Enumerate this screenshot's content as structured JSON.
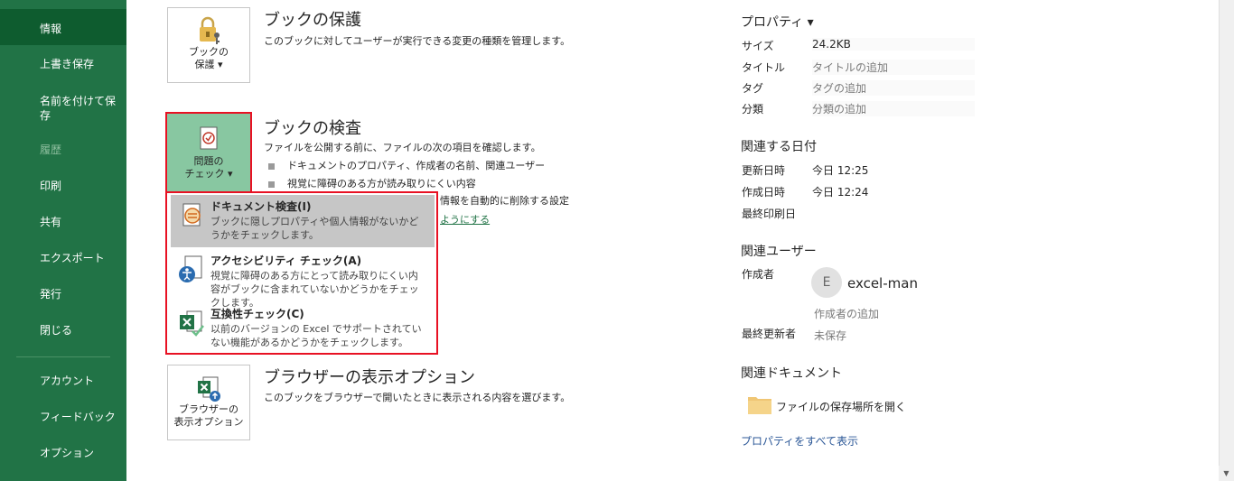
{
  "sidebar": {
    "items": [
      {
        "label": "情報"
      },
      {
        "label": "上書き保存"
      },
      {
        "label": "名前を付けて保\n存"
      },
      {
        "label": "履歴"
      },
      {
        "label": "印刷"
      },
      {
        "label": "共有"
      },
      {
        "label": "エクスポート"
      },
      {
        "label": "発行"
      },
      {
        "label": "閉じる"
      },
      {
        "label": "アカウント"
      },
      {
        "label": "フィードバック"
      },
      {
        "label": "オプション"
      }
    ]
  },
  "protect": {
    "button_line1": "ブックの",
    "button_line2": "保護 ▾",
    "title": "ブックの保護",
    "desc": "このブックに対してユーザーが実行できる変更の種類を管理します。"
  },
  "inspect": {
    "button_line1": "問題の",
    "button_line2": "チェック ▾",
    "title": "ブックの検査",
    "desc": "ファイルを公開する前に、ファイルの次の項目を確認します。",
    "bullet1": "ドキュメントのプロパティ、作成者の名前、関連ユーザー",
    "bullet2": "視覚に障碍のある方が読み取りにくい内容",
    "bullet3_tail": "情報を自動的に削除する設定",
    "link_tail": "ようにする"
  },
  "dropdown": {
    "items": [
      {
        "title": "ドキュメント検査(I)",
        "desc": "ブックに隠しプロパティや個人情報がないかどうかをチェックします。"
      },
      {
        "title": "アクセシビリティ チェック(A)",
        "desc": "視覚に障碍のある方にとって読み取りにくい内容がブックに含まれていないかどうかをチェックします。"
      },
      {
        "title": "互換性チェック(C)",
        "desc": "以前のバージョンの Excel でサポートされていない機能があるかどうかをチェックします。"
      }
    ]
  },
  "browser": {
    "button_line1": "ブラウザーの",
    "button_line2": "表示オプション",
    "title": "ブラウザーの表示オプション",
    "desc": "このブックをブラウザーで開いたときに表示される内容を選びます。"
  },
  "properties": {
    "header": "プロパティ ▾",
    "size_label": "サイズ",
    "size_value": "24.2KB",
    "title_label": "タイトル",
    "title_value": "タイトルの追加",
    "tags_label": "タグ",
    "tags_value": "タグの追加",
    "category_label": "分類",
    "category_value": "分類の追加"
  },
  "dates": {
    "header": "関連する日付",
    "modified_label": "更新日時",
    "modified_value": "今日 12:25",
    "created_label": "作成日時",
    "created_value": "今日 12:24",
    "printed_label": "最終印刷日"
  },
  "people": {
    "header": "関連ユーザー",
    "author_label": "作成者",
    "author_initial": "E",
    "author_name": "excel-man",
    "add_author": "作成者の追加",
    "last_modified_label": "最終更新者",
    "last_modified_value": "未保存"
  },
  "documents": {
    "header": "関連ドキュメント",
    "open_location": "ファイルの保存場所を開く",
    "show_all": "プロパティをすべて表示"
  },
  "colors": {
    "sidebar": "#217346",
    "active": "#0e5c2f",
    "highlight": "#e81123"
  }
}
